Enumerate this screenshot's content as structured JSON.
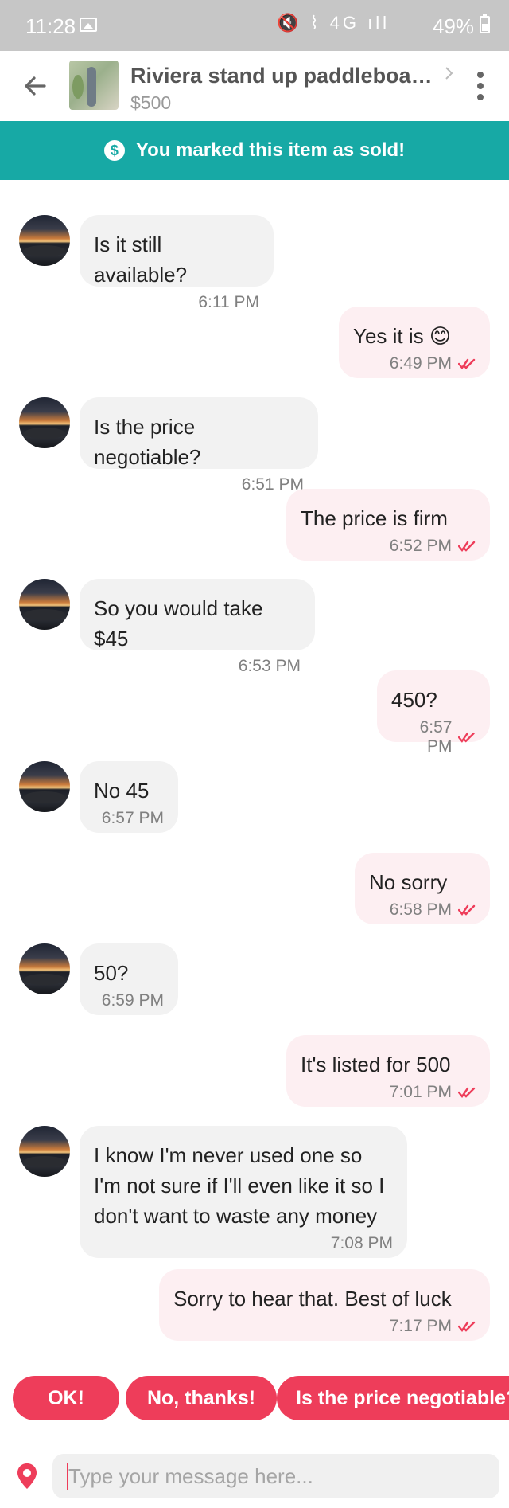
{
  "status_bar": {
    "time": "11:28",
    "icons": "🔇 ⌇ 4G ıll",
    "battery": "49%"
  },
  "header": {
    "item_title": "Riviera stand up paddleboard...",
    "item_price": "$500"
  },
  "banner": {
    "icon_label": "$",
    "text": "You marked this item as sold!"
  },
  "messages": [
    {
      "from": "them",
      "text": "Is it still available?",
      "time": "6:11 PM"
    },
    {
      "from": "me",
      "text": "Yes it is 😊",
      "time": "6:49 PM"
    },
    {
      "from": "them",
      "text": "Is the price negotiable?",
      "time": "6:51 PM"
    },
    {
      "from": "me",
      "text": "The price is firm",
      "time": "6:52 PM"
    },
    {
      "from": "them",
      "text": "So you would take $45",
      "time": "6:53 PM"
    },
    {
      "from": "me",
      "text": "450?",
      "time": "6:57 PM"
    },
    {
      "from": "them",
      "text": "No 45",
      "time": "6:57 PM"
    },
    {
      "from": "me",
      "text": "No sorry",
      "time": "6:58 PM"
    },
    {
      "from": "them",
      "text": "50?",
      "time": "6:59 PM"
    },
    {
      "from": "me",
      "text": "It's listed for 500",
      "time": "7:01 PM"
    },
    {
      "from": "them",
      "text": "I know I'm never used one so I'm not sure if I'll even like it so I don't want to waste any money",
      "time": "7:08 PM"
    },
    {
      "from": "me",
      "text": "Sorry to hear that. Best of luck",
      "time": "7:17 PM"
    }
  ],
  "quick_replies": [
    "OK!",
    "No, thanks!",
    "Is the price negotiable?"
  ],
  "composer": {
    "placeholder": "Type your message here..."
  },
  "colors": {
    "teal": "#17a9a5",
    "accent": "#ee3d5a",
    "incoming_bubble": "#f2f2f2",
    "outgoing_bubble": "#fdeff2"
  }
}
